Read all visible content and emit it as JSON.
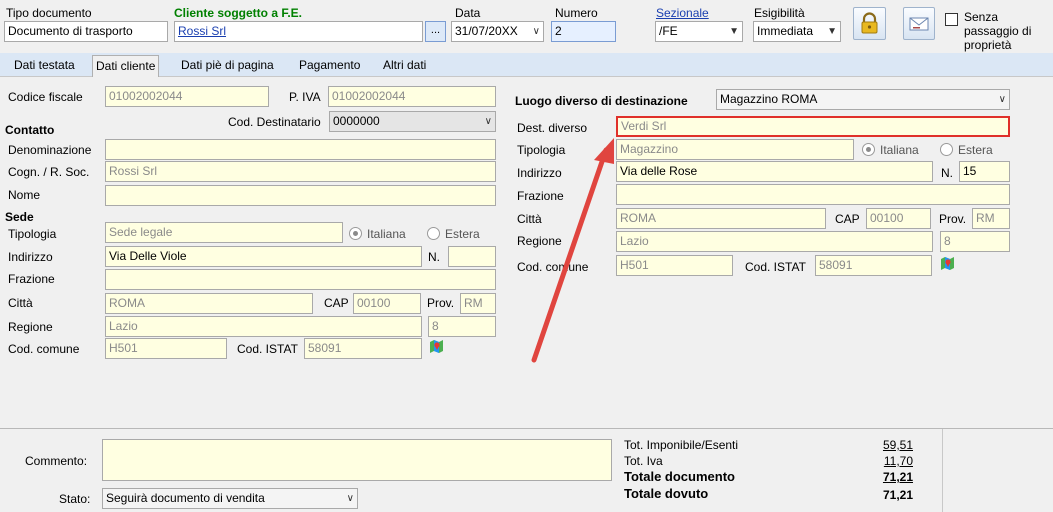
{
  "header": {
    "tipo_label": "Tipo documento",
    "tipo_value": "Documento di trasporto",
    "cliente_label": "Cliente soggetto a F.E.",
    "cliente_value": "Rossi Srl",
    "browse_label": "...",
    "data_label": "Data",
    "data_value": "31/07/20XX",
    "numero_label": "Numero",
    "numero_value": "2",
    "sezionale_label": "Sezionale",
    "sezionale_value": "/FE",
    "esig_label": "Esigibilità",
    "esig_value": "Immediata",
    "senza_label": "Senza passaggio di proprietà"
  },
  "tabs": [
    "Dati testata",
    "Dati cliente",
    "Dati piè di pagina",
    "Pagamento",
    "Altri dati"
  ],
  "left": {
    "codice_fiscale_label": "Codice fiscale",
    "codice_fiscale": "01002002044",
    "piva_label": "P. IVA",
    "piva": "01002002044",
    "cod_dest_label": "Cod. Destinatario",
    "cod_dest": "0000000",
    "contatto_label": "Contatto",
    "denominazione_label": "Denominazione",
    "denominazione": "",
    "cognome_label": "Cogn. / R. Soc.",
    "cognome": "Rossi Srl",
    "nome_label": "Nome",
    "nome": "",
    "sede_label": "Sede",
    "tipologia_label": "Tipologia",
    "tipologia": "Sede legale",
    "italiana": "Italiana",
    "estera": "Estera",
    "indirizzo_label": "Indirizzo",
    "indirizzo": "Via Delle Viole",
    "n_label": "N.",
    "n_value": "",
    "frazione_label": "Frazione",
    "frazione": "",
    "citta_label": "Città",
    "citta": "ROMA",
    "cap_label": "CAP",
    "cap": "00100",
    "prov_label": "Prov.",
    "prov": "RM",
    "regione_label": "Regione",
    "regione": "Lazio",
    "regione_code": "8",
    "cod_comune_label": "Cod. comune",
    "cod_comune": "H501",
    "cod_istat_label": "Cod. ISTAT",
    "cod_istat": "58091"
  },
  "right": {
    "luogo_label": "Luogo diverso di destinazione",
    "luogo_value": "Magazzino ROMA",
    "dest_label": "Dest. diverso",
    "dest_value": "Verdi Srl",
    "tipologia_label": "Tipologia",
    "tipologia": "Magazzino",
    "italiana": "Italiana",
    "estera": "Estera",
    "indirizzo_label": "Indirizzo",
    "indirizzo": "Via delle Rose",
    "n_label": "N.",
    "n_value": "15",
    "frazione_label": "Frazione",
    "frazione": "",
    "citta_label": "Città",
    "citta": "ROMA",
    "cap_label": "CAP",
    "cap": "00100",
    "prov_label": "Prov.",
    "prov": "RM",
    "regione_label": "Regione",
    "regione": "Lazio",
    "regione_code": "8",
    "cod_comune_label": "Cod. comune",
    "cod_comune": "H501",
    "cod_istat_label": "Cod. ISTAT",
    "cod_istat": "58091"
  },
  "footer": {
    "commento_label": "Commento:",
    "commento": "",
    "stato_label": "Stato:",
    "stato_value": "Seguirà documento di vendita",
    "imponibile_label": "Tot. Imponibile/Esenti",
    "imponibile": "59,51",
    "iva_label": "Tot. Iva",
    "iva": "11,70",
    "totale_doc_label": "Totale documento",
    "totale_doc": "71,21",
    "totale_dovuto_label": "Totale dovuto",
    "totale_dovuto": "71,21"
  },
  "colors": {
    "highlight_border": "#e0302a",
    "arrow": "#e0453f",
    "field_bg": "#ffffe1",
    "tab_bar": "#dbe7f5"
  },
  "icons": [
    "lock-icon",
    "email-icon",
    "map-icon"
  ]
}
